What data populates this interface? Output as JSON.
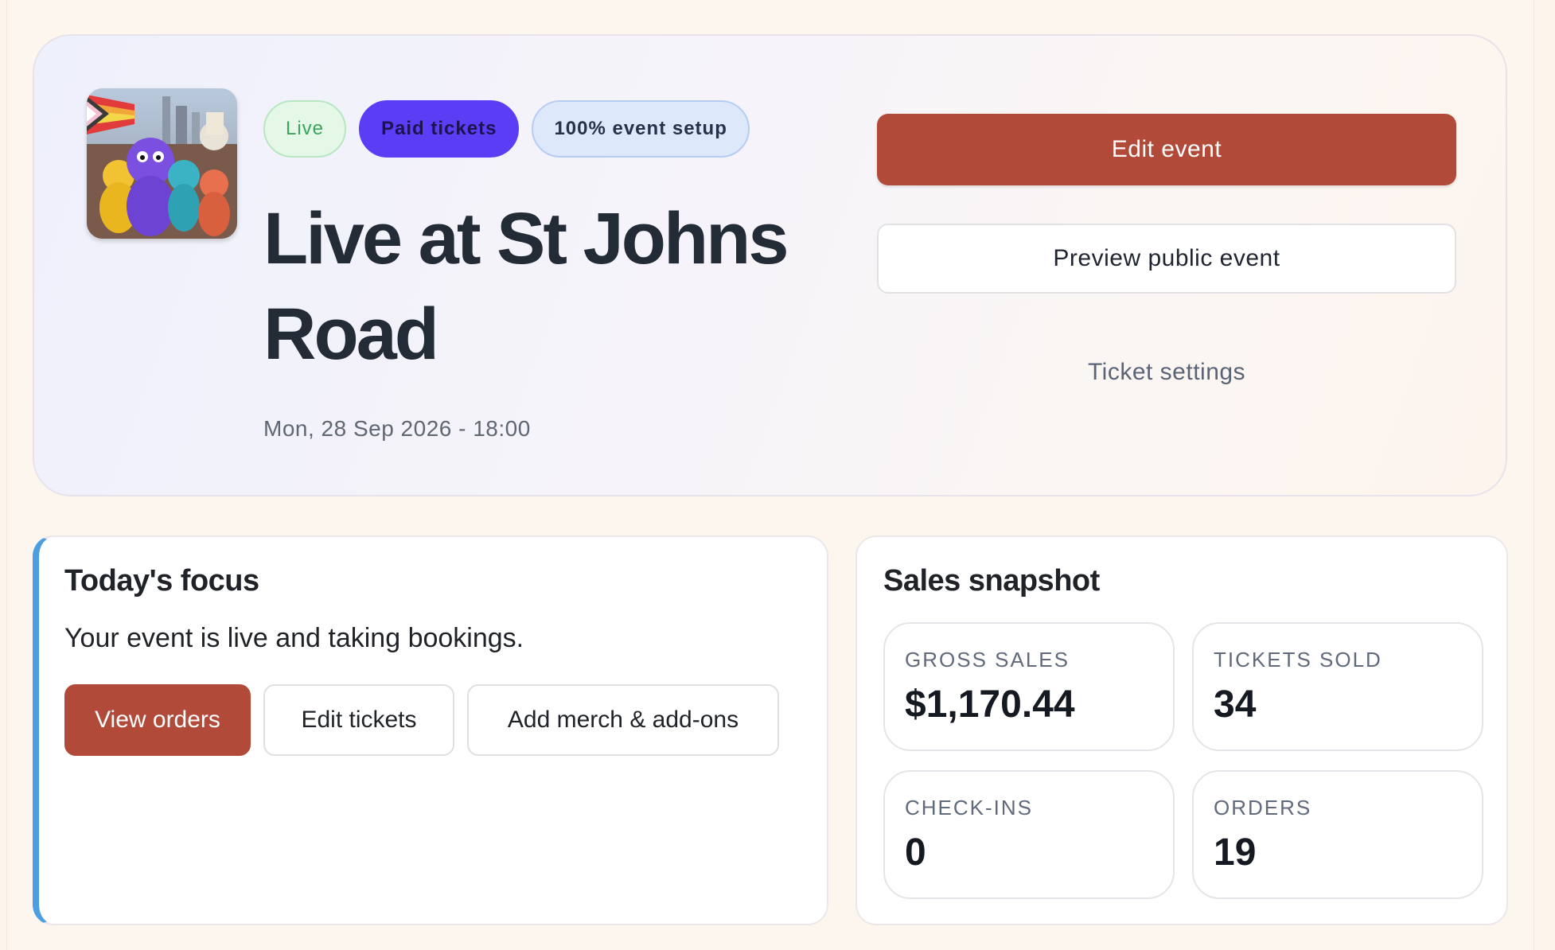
{
  "event": {
    "status_badge": "Live",
    "ticket_type_badge": "Paid tickets",
    "setup_badge": "100% event setup",
    "title": "Live at St Johns Road",
    "date": "Mon, 28 Sep 2026 - 18:00",
    "image_alt": "Colourful costumed characters at a pride parade"
  },
  "actions": {
    "edit_event": "Edit event",
    "preview_public_event": "Preview public event",
    "ticket_settings": "Ticket settings"
  },
  "focus": {
    "title": "Today's focus",
    "message": "Your event is live and taking bookings.",
    "buttons": {
      "view_orders": "View orders",
      "edit_tickets": "Edit tickets",
      "add_merch": "Add merch & add-ons"
    }
  },
  "sales": {
    "title": "Sales snapshot",
    "stats": {
      "gross_sales": {
        "label": "GROSS SALES",
        "value": "$1,170.44"
      },
      "tickets_sold": {
        "label": "TICKETS SOLD",
        "value": "34"
      },
      "check_ins": {
        "label": "CHECK-INS",
        "value": "0"
      },
      "orders": {
        "label": "ORDERS",
        "value": "19"
      }
    }
  },
  "colors": {
    "accent": "#b24a39",
    "paid_badge": "#5b3df5",
    "focus_border": "#4b9ee0",
    "live_badge": "#3aa55a"
  }
}
